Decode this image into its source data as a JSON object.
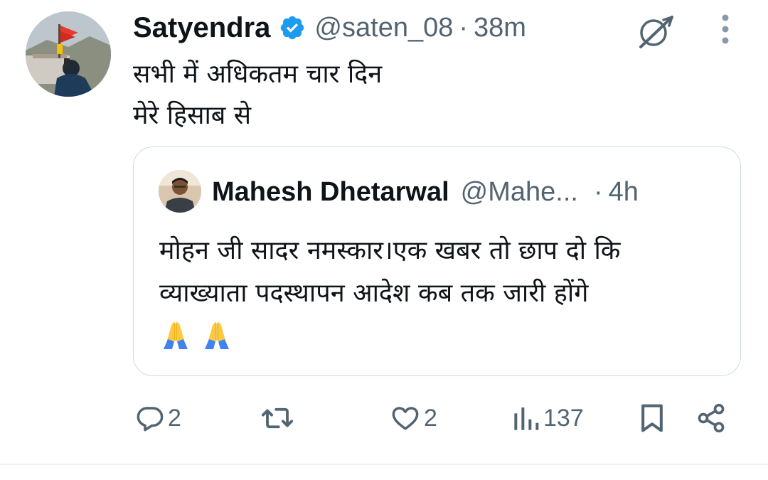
{
  "tweet": {
    "author": {
      "display_name": "Satyendra",
      "handle": "@saten_08",
      "verified": true,
      "avatar_icon": "profile-photo"
    },
    "separator": "·",
    "time": "38m",
    "text_lines": [
      "सभी में अधिकतम चार दिन",
      "मेरे हिसाब से"
    ],
    "quoted": {
      "display_name": "Mahesh Dhetarwal",
      "handle": "@Mahe...",
      "separator": "·",
      "time": "4h",
      "text_lines": [
        "मोहन जी सादर नमस्कार।एक खबर तो छाप दो कि",
        "व्याख्याता पदस्थापन आदेश कब तक जारी होंगे"
      ],
      "emojis": [
        "folded-hands",
        "folded-hands"
      ]
    },
    "actions": {
      "replies": "2",
      "reposts": "",
      "likes": "2",
      "views": "137"
    }
  },
  "colors": {
    "text": "#0f1419",
    "secondary": "#536471",
    "verified_blue": "#1d9bf0",
    "border": "#cfd9de"
  }
}
